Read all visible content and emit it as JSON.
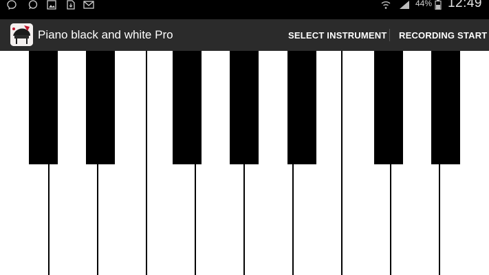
{
  "status_bar": {
    "icons": [
      "messenger-icon",
      "whatsapp-icon",
      "gallery-icon",
      "file-download-icon",
      "email-icon",
      "wifi-icon",
      "signal-icon",
      "battery-icon"
    ],
    "battery": "44%",
    "time": "12:49"
  },
  "app_bar": {
    "title": "Piano black and white Pro",
    "select_instrument": "SELECT INSTRUMENT",
    "recording_start": "RECORDING START"
  },
  "piano": {
    "white_key_count": 10,
    "black_key_count": 7
  }
}
